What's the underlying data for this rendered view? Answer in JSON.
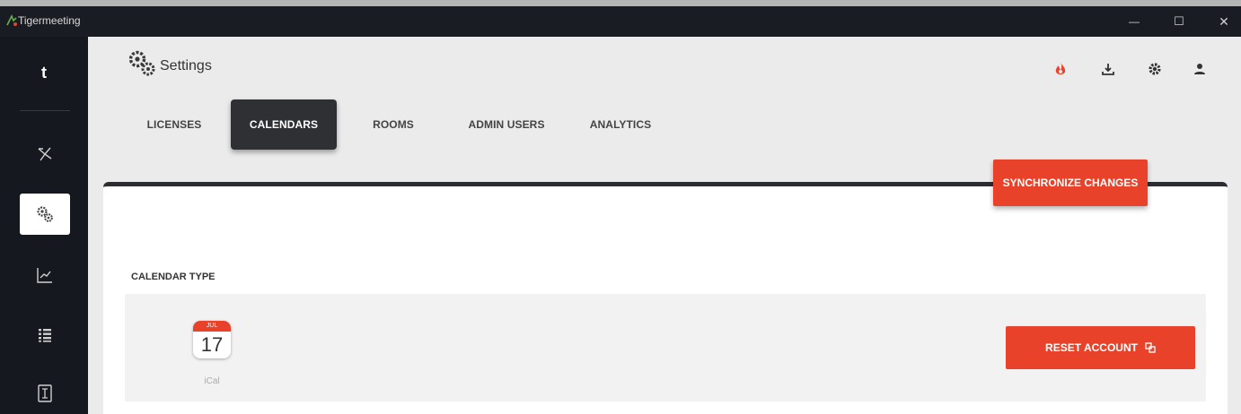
{
  "window": {
    "title": "Tigermeeting",
    "minimize_glyph": "—",
    "maximize_glyph": "☐",
    "close_glyph": "✕"
  },
  "sidebar": {
    "brand": "t",
    "items": [
      {
        "icon": "network-icon"
      },
      {
        "icon": "gears-icon",
        "active": true
      },
      {
        "icon": "chart-icon"
      },
      {
        "icon": "list-icon"
      },
      {
        "icon": "document-icon"
      }
    ]
  },
  "header": {
    "title": "Settings",
    "icons": [
      "fire-icon",
      "download-icon",
      "gear-icon",
      "user-icon"
    ]
  },
  "tabs": [
    {
      "label": "LICENSES"
    },
    {
      "label": "CALENDARS",
      "active": true
    },
    {
      "label": "ROOMS"
    },
    {
      "label": "ADMIN USERS"
    },
    {
      "label": "ANALYTICS"
    }
  ],
  "content": {
    "sync_button": "SYNCHRONIZE CHANGES",
    "calendar_type_label": "CALENDAR TYPE",
    "calendar": {
      "icon_month": "JUL",
      "icon_day": "17",
      "name": "iCal"
    },
    "reset_button": "RESET ACCOUNT"
  },
  "colors": {
    "accent": "#e8432a",
    "sidebar_bg": "#16181f",
    "titlebar_bg": "#1a1c24",
    "page_bg": "#ebebeb",
    "active_tab": "#2f3033"
  }
}
